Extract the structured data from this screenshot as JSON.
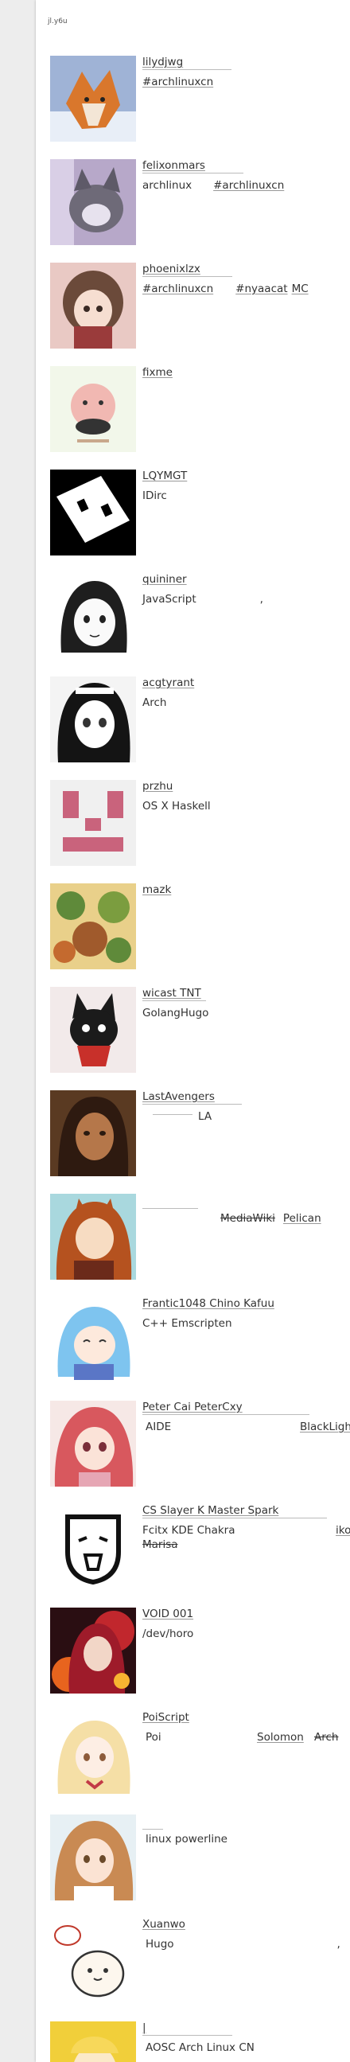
{
  "site": {
    "title": "jl.y6u"
  },
  "friends": [
    {
      "name": "lilydjwg",
      "desc": "#archlinuxcn"
    },
    {
      "name": "felixonmars",
      "desc_a": "archlinux",
      "desc_b": "#archlinuxcn"
    },
    {
      "name": "phoenixlzx",
      "desc_a": "#archlinuxcn",
      "desc_b": "#nyaacat",
      "desc_c": "MC"
    },
    {
      "name": "fixme",
      "desc": ""
    },
    {
      "name": "LQYMGT",
      "desc": "IDirc"
    },
    {
      "name": "quininer",
      "desc": "JavaScript",
      "mark": ","
    },
    {
      "name": "acgtyrant",
      "desc": "Arch"
    },
    {
      "name": "przhu",
      "desc": "OS X Haskell"
    },
    {
      "name": "mazk",
      "desc": ""
    },
    {
      "name": "wicast TNT",
      "desc": "GolangHugo"
    },
    {
      "name": "LastAvengers",
      "desc": "LA"
    },
    {
      "name": "",
      "desc_a": "MediaWiki",
      "desc_b": "Pelican"
    },
    {
      "name": "Frantic1048 Chino Kafuu",
      "desc": "C++  Emscripten"
    },
    {
      "name": "Peter Cai  PeterCxy",
      "desc_a": "AIDE",
      "desc_b": "BlackLigh"
    },
    {
      "name": "CS Slayer K    Master Spark",
      "desc_a": "Fcitx   KDE  Chakra",
      "desc_b": "iko",
      "desc_c": "Marisa"
    },
    {
      "name": "VOID 001",
      "desc": "/dev/horo"
    },
    {
      "name": "PoiScript",
      "desc_a": "Poi",
      "desc_b": "Solomon",
      "desc_c": "Arch"
    },
    {
      "name": "",
      "desc": "linux  powerline"
    },
    {
      "name": "Xuanwo",
      "desc": "Hugo",
      "mark": ","
    },
    {
      "name": "|",
      "desc": "AOSC  Arch Linux CN"
    }
  ],
  "colors": {
    "page_bg": "#ededed",
    "card_bg": "#ffffff",
    "text": "#333333",
    "rule": "#bbbbbb"
  }
}
